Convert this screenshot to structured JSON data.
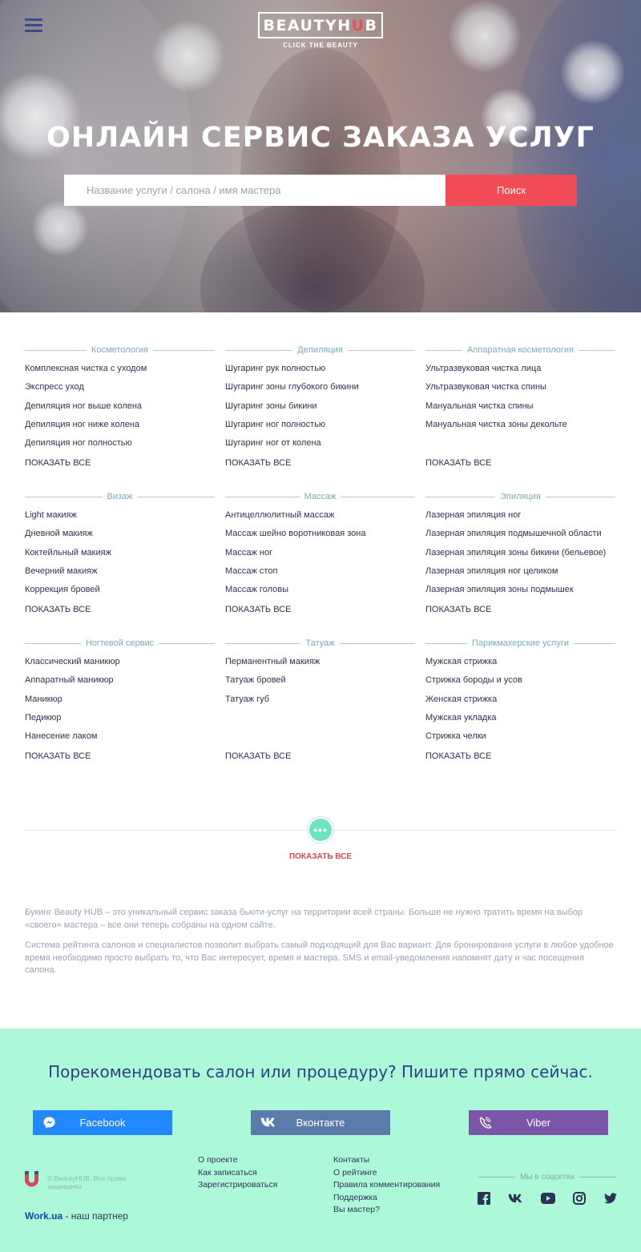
{
  "header": {
    "logo_text_left": "BEAUTYH",
    "logo_text_u": "U",
    "logo_text_right": "B",
    "logo_tagline": "CLICK THE BEAUTY",
    "title": "ОНЛАЙН СЕРВИС ЗАКАЗА УСЛУГ",
    "search_placeholder": "Название услуги / салона / имя мастера",
    "search_button": "Поиск"
  },
  "categories": [
    {
      "title": "Косметология",
      "items": [
        "Комплексная чистка с уходом",
        "Экспресс уход",
        "Депиляция ног выше колена",
        "Депиляция ног ниже колена",
        "Депиляция ног полностью"
      ],
      "show_all": "ПОКАЗАТЬ ВСЕ"
    },
    {
      "title": "Депиляция",
      "items": [
        "Шугаринг рук полностью",
        "Шугаринг зоны глубокого бикини",
        "Шугаринг зоны бикини",
        "Шугаринг ног полностью",
        "Шугаринг ног от колена"
      ],
      "show_all": "ПОКАЗАТЬ ВСЕ"
    },
    {
      "title": "Аппаратная косметология",
      "items": [
        "Ультразвуковая чистка лица",
        "Ультразвуковая чистка спины",
        "Мануальная чистка спины",
        "Мануальная чистка зоны декольте"
      ],
      "show_all": "ПОКАЗАТЬ ВСЕ"
    },
    {
      "title": "Визаж",
      "items": [
        "Light макияж",
        "Дневной макияж",
        "Коктейльный макияж",
        "Вечерний макияж",
        "Коррекция бровей"
      ],
      "show_all": "ПОКАЗАТЬ ВСЕ"
    },
    {
      "title": "Массаж",
      "items": [
        "Антицеллюлитный массаж",
        "Массаж шейно воротниковая зона",
        "Массаж ног",
        "Массаж стоп",
        "Массаж головы"
      ],
      "show_all": "ПОКАЗАТЬ ВСЕ"
    },
    {
      "title": "Эпиляция",
      "items": [
        "Лазерная эпиляция ног",
        "Лазерная эпиляция подмышечной области",
        "Лазерная эпиляция зоны бикини (бельевое)",
        "Лазерная эпиляция ног целиком",
        "Лазерная эпиляция зоны подмышек"
      ],
      "show_all": "ПОКАЗАТЬ ВСЕ"
    },
    {
      "title": "Ногтевой сервис",
      "items": [
        "Классический маникюр",
        "Аппаратный маникюр",
        "Маникюр",
        "Педикюр",
        "Нанесение лаком"
      ],
      "show_all": "ПОКАЗАТЬ ВСЕ"
    },
    {
      "title": "Татуаж",
      "items": [
        "Перманентный макияж",
        "Татуаж бровей",
        "Татуаж губ"
      ],
      "show_all": "ПОКАЗАТЬ ВСЕ"
    },
    {
      "title": "Парикмахерские услуги",
      "items": [
        "Мужская стрижка",
        "Стрижка бороды и усов",
        "Женская стрижка",
        "Мужская укладка",
        "Стрижка челки"
      ],
      "show_all": "ПОКАЗАТЬ ВСЕ"
    }
  ],
  "more": {
    "dots": "•••",
    "label": "ПОКАЗАТЬ ВСЕ"
  },
  "description": {
    "p1": "Букинг Beauty HUB – это уникальный сервис заказа бьюти-услуг на территории всей страны. Больше не нужно тратить время на выбор «своего» мастера – все они теперь собраны на одном сайте.",
    "p2": "Система рейтинга салонов и специалистов позволит выбрать самый подходящий для Вас вариант. Для бронирования услуги в любое удобное время необходимо просто выбрать то, что Вас интересует, время и мастера. SMS и email-уведомления напомнят дату и час посещения салона."
  },
  "footer": {
    "cta": "Порекомендовать салон или процедуру? Пишите прямо сейчас.",
    "share": {
      "facebook": "Facebook",
      "vkontakte": "Вконтакте",
      "viber": "Viber"
    },
    "copyright": "© BeautyHUB. Все права защищены",
    "partner_name": "Work.ua",
    "partner_suffix": " - наш партнер",
    "links_col1": [
      "О проекте",
      "Как записаться",
      "Зарегистрироваться"
    ],
    "links_col2": [
      "Контакты",
      "О рейтинге",
      "Правила комментирования",
      "Поддержка",
      "Вы мастер?"
    ],
    "social_title": "Мы в соцсетях",
    "social_icons": [
      "facebook-icon",
      "vk-icon",
      "youtube-icon",
      "instagram-icon",
      "twitter-icon"
    ]
  },
  "colors": {
    "accent": "#f04b57",
    "brand_navy": "#2d3f86",
    "mint": "#aef8da",
    "teal_dot": "#6ee3c1",
    "facebook": "#2188ff",
    "vk": "#5b7cab",
    "viber": "#7b56a8"
  }
}
